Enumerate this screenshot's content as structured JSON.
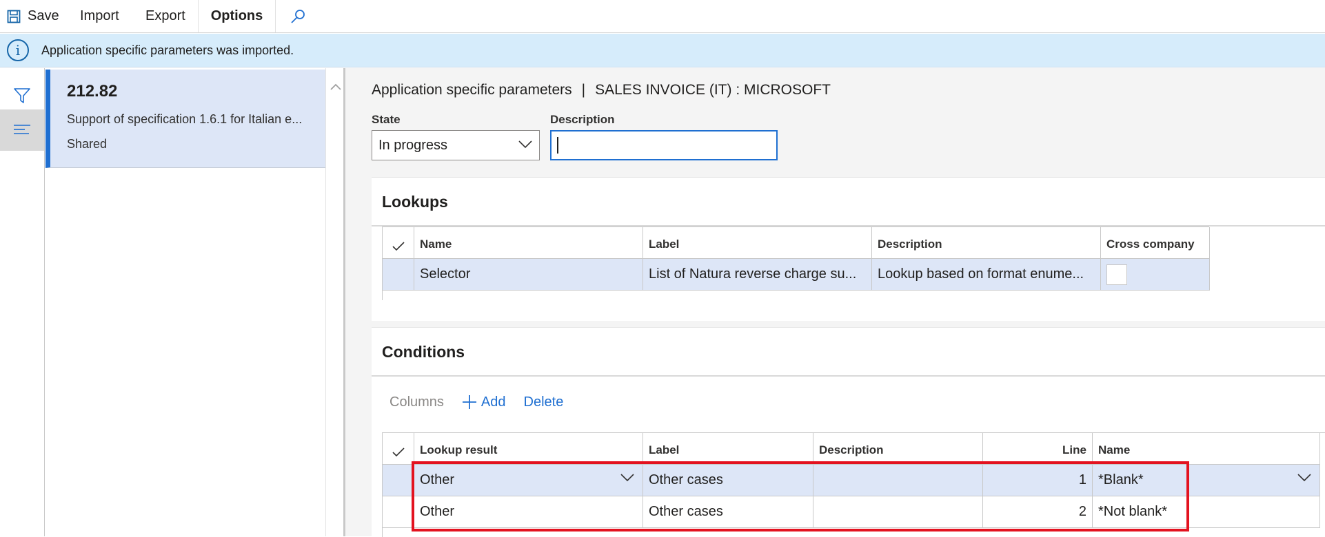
{
  "toolbar": {
    "save_label": "Save",
    "import_label": "Import",
    "export_label": "Export",
    "options_label": "Options"
  },
  "message_bar": {
    "icon": "info-icon",
    "text": "Application specific parameters was imported."
  },
  "list_pane": {
    "card": {
      "title": "212.82",
      "subtitle": "Support of specification 1.6.1 for Italian e...",
      "status": "Shared"
    }
  },
  "main": {
    "breadcrumb": {
      "left": "Application specific parameters",
      "separator": "|",
      "right": "SALES INVOICE (IT) : MICROSOFT"
    },
    "state": {
      "label": "State",
      "value": "In progress"
    },
    "description": {
      "label": "Description",
      "value": ""
    }
  },
  "lookups": {
    "title": "Lookups",
    "columns": [
      "Name",
      "Label",
      "Description",
      "Cross company"
    ],
    "rows": [
      {
        "name": "Selector",
        "label": "List of Natura reverse charge su...",
        "description": "Lookup based on format enume...",
        "cross_company": false
      }
    ]
  },
  "conditions": {
    "title": "Conditions",
    "actions": {
      "columns": "Columns",
      "add": "Add",
      "delete": "Delete"
    },
    "columns": [
      "Lookup result",
      "Label",
      "Description",
      "Line",
      "Name"
    ],
    "rows": [
      {
        "lookup_result": "Other",
        "label": "Other cases",
        "description": "",
        "line": "1",
        "name": "*Blank*"
      },
      {
        "lookup_result": "Other",
        "label": "Other cases",
        "description": "",
        "line": "2",
        "name": "*Not blank*"
      }
    ]
  },
  "colors": {
    "accent": "#1f6fd1",
    "message_bg": "#d6ecfb",
    "selected_row": "#dde6f7",
    "highlight": "#e3121f"
  }
}
